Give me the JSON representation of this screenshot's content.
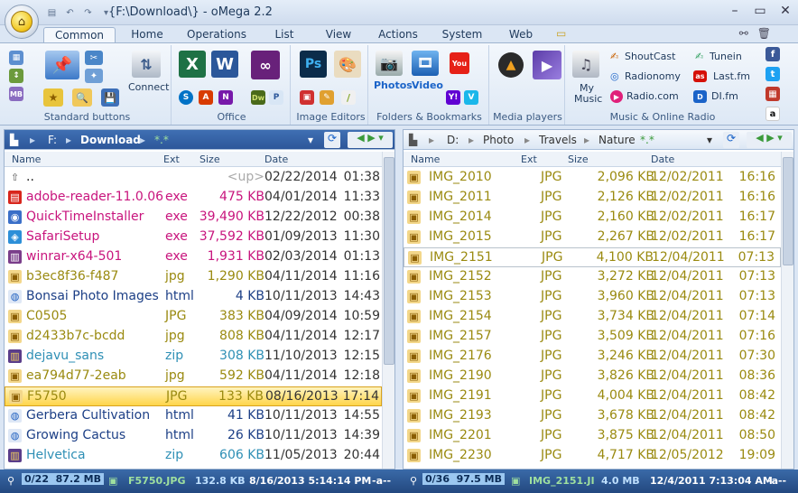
{
  "window": {
    "title_prefix": "{F:\\Download\\}",
    "title_sep": " - ",
    "title_app": "oMega 2.2"
  },
  "tabs": [
    "Common",
    "Home",
    "Operations",
    "List",
    "View",
    "Actions",
    "System",
    "Web"
  ],
  "ribbon": {
    "groups": [
      "Standard buttons",
      "Office",
      "Image Editors",
      "Folders & Bookmarks",
      "Media players",
      "Music & Online Radio"
    ],
    "connect_label": "Connect",
    "photos_label": "Photos",
    "video_label": "Video",
    "mymusic_label": "My Music",
    "radio": [
      "ShoutCast",
      "Tunein",
      "Radionomy",
      "Last.fm",
      "Radio.com",
      "DI.fm"
    ]
  },
  "left": {
    "path": [
      "F:",
      "Download",
      "*.*"
    ],
    "cols": [
      "Name",
      "Ext",
      "Size",
      "Date"
    ],
    "rows": [
      {
        "name": "..",
        "ext": "",
        "size": "<up>",
        "date": "02/22/2014",
        "time": "01:38",
        "color": "#222222",
        "icon": "up"
      },
      {
        "name": "adobe-reader-11.0.06",
        "ext": "exe",
        "size": "475 KB",
        "date": "04/01/2014",
        "time": "11:33",
        "color": "#c8147d",
        "icon": "pdf"
      },
      {
        "name": "QuickTimeInstaller",
        "ext": "exe",
        "size": "39,490 KB",
        "date": "12/22/2012",
        "time": "00:38",
        "color": "#c8147d",
        "icon": "qt"
      },
      {
        "name": "SafariSetup",
        "ext": "exe",
        "size": "37,592 KB",
        "date": "01/09/2013",
        "time": "11:30",
        "color": "#c8147d",
        "icon": "saf"
      },
      {
        "name": "winrar-x64-501",
        "ext": "exe",
        "size": "1,931 KB",
        "date": "02/03/2014",
        "time": "01:13",
        "color": "#c8147d",
        "icon": "rar"
      },
      {
        "name": "b3ec8f36-f487",
        "ext": "jpg",
        "size": "1,290 KB",
        "date": "04/11/2014",
        "time": "11:16",
        "color": "#9a8a10",
        "icon": "img"
      },
      {
        "name": "Bonsai Photo Images",
        "ext": "html",
        "size": "4 KB",
        "date": "10/11/2013",
        "time": "14:43",
        "color": "#1c3f86",
        "icon": "web"
      },
      {
        "name": "C0505",
        "ext": "JPG",
        "size": "383 KB",
        "date": "04/09/2014",
        "time": "10:59",
        "color": "#9a8a10",
        "icon": "img"
      },
      {
        "name": "d2433b7c-bcdd",
        "ext": "jpg",
        "size": "808 KB",
        "date": "04/11/2014",
        "time": "12:17",
        "color": "#9a8a10",
        "icon": "img"
      },
      {
        "name": "dejavu_sans",
        "ext": "zip",
        "size": "308 KB",
        "date": "11/10/2013",
        "time": "12:15",
        "color": "#2e8fb5",
        "icon": "zip"
      },
      {
        "name": "ea794d77-2eab",
        "ext": "jpg",
        "size": "592 KB",
        "date": "04/11/2014",
        "time": "12:18",
        "color": "#9a8a10",
        "icon": "img"
      },
      {
        "name": "F5750",
        "ext": "JPG",
        "size": "133 KB",
        "date": "08/16/2013",
        "time": "17:14",
        "color": "#9a8a10",
        "icon": "img",
        "highlight": true
      },
      {
        "name": "Gerbera Cultivation",
        "ext": "html",
        "size": "41 KB",
        "date": "10/11/2013",
        "time": "14:55",
        "color": "#1c3f86",
        "icon": "web"
      },
      {
        "name": "Growing Cactus",
        "ext": "html",
        "size": "26 KB",
        "date": "10/11/2013",
        "time": "14:39",
        "color": "#1c3f86",
        "icon": "web"
      },
      {
        "name": "Helvetica",
        "ext": "zip",
        "size": "606 KB",
        "date": "11/05/2013",
        "time": "20:44",
        "color": "#2e8fb5",
        "icon": "zip"
      }
    ]
  },
  "right": {
    "path": [
      "D:",
      "Photo",
      "Travels",
      "Nature",
      "*.*"
    ],
    "cols": [
      "Name",
      "Ext",
      "Size",
      "Date"
    ],
    "rows": [
      {
        "name": "IMG_2010",
        "ext": "JPG",
        "size": "2,096 KB",
        "date": "12/02/2011",
        "time": "16:16"
      },
      {
        "name": "IMG_2011",
        "ext": "JPG",
        "size": "2,126 KB",
        "date": "12/02/2011",
        "time": "16:16"
      },
      {
        "name": "IMG_2014",
        "ext": "JPG",
        "size": "2,160 KB",
        "date": "12/02/2011",
        "time": "16:17"
      },
      {
        "name": "IMG_2015",
        "ext": "JPG",
        "size": "2,267 KB",
        "date": "12/02/2011",
        "time": "16:17"
      },
      {
        "name": "IMG_2151",
        "ext": "JPG",
        "size": "4,100 KB",
        "date": "12/04/2011",
        "time": "07:13",
        "current": true
      },
      {
        "name": "IMG_2152",
        "ext": "JPG",
        "size": "3,272 KB",
        "date": "12/04/2011",
        "time": "07:13"
      },
      {
        "name": "IMG_2153",
        "ext": "JPG",
        "size": "3,960 KB",
        "date": "12/04/2011",
        "time": "07:13"
      },
      {
        "name": "IMG_2154",
        "ext": "JPG",
        "size": "3,734 KB",
        "date": "12/04/2011",
        "time": "07:14"
      },
      {
        "name": "IMG_2157",
        "ext": "JPG",
        "size": "3,509 KB",
        "date": "12/04/2011",
        "time": "07:16"
      },
      {
        "name": "IMG_2176",
        "ext": "JPG",
        "size": "3,246 KB",
        "date": "12/04/2011",
        "time": "07:30"
      },
      {
        "name": "IMG_2190",
        "ext": "JPG",
        "size": "3,826 KB",
        "date": "12/04/2011",
        "time": "08:36"
      },
      {
        "name": "IMG_2191",
        "ext": "JPG",
        "size": "4,004 KB",
        "date": "12/04/2011",
        "time": "08:42"
      },
      {
        "name": "IMG_2193",
        "ext": "JPG",
        "size": "3,678 KB",
        "date": "12/04/2011",
        "time": "08:42"
      },
      {
        "name": "IMG_2201",
        "ext": "JPG",
        "size": "3,875 KB",
        "date": "12/04/2011",
        "time": "08:50"
      },
      {
        "name": "IMG_2230",
        "ext": "JPG",
        "size": "4,717 KB",
        "date": "12/05/2012",
        "time": "19:09"
      }
    ]
  },
  "status": {
    "left_count": "0/22",
    "left_total": "87.2 MB",
    "left_file": "F5750.JPG",
    "left_size": "132.8 KB",
    "left_date": "8/16/2013 5:14:14 PM",
    "left_attr": "-a--",
    "right_count": "0/36",
    "right_total": "97.5 MB",
    "right_file": "IMG_2151.JI",
    "right_size": "4.0 MB",
    "right_date": "12/4/2011 7:13:04 AM",
    "right_attr": "-a--"
  }
}
